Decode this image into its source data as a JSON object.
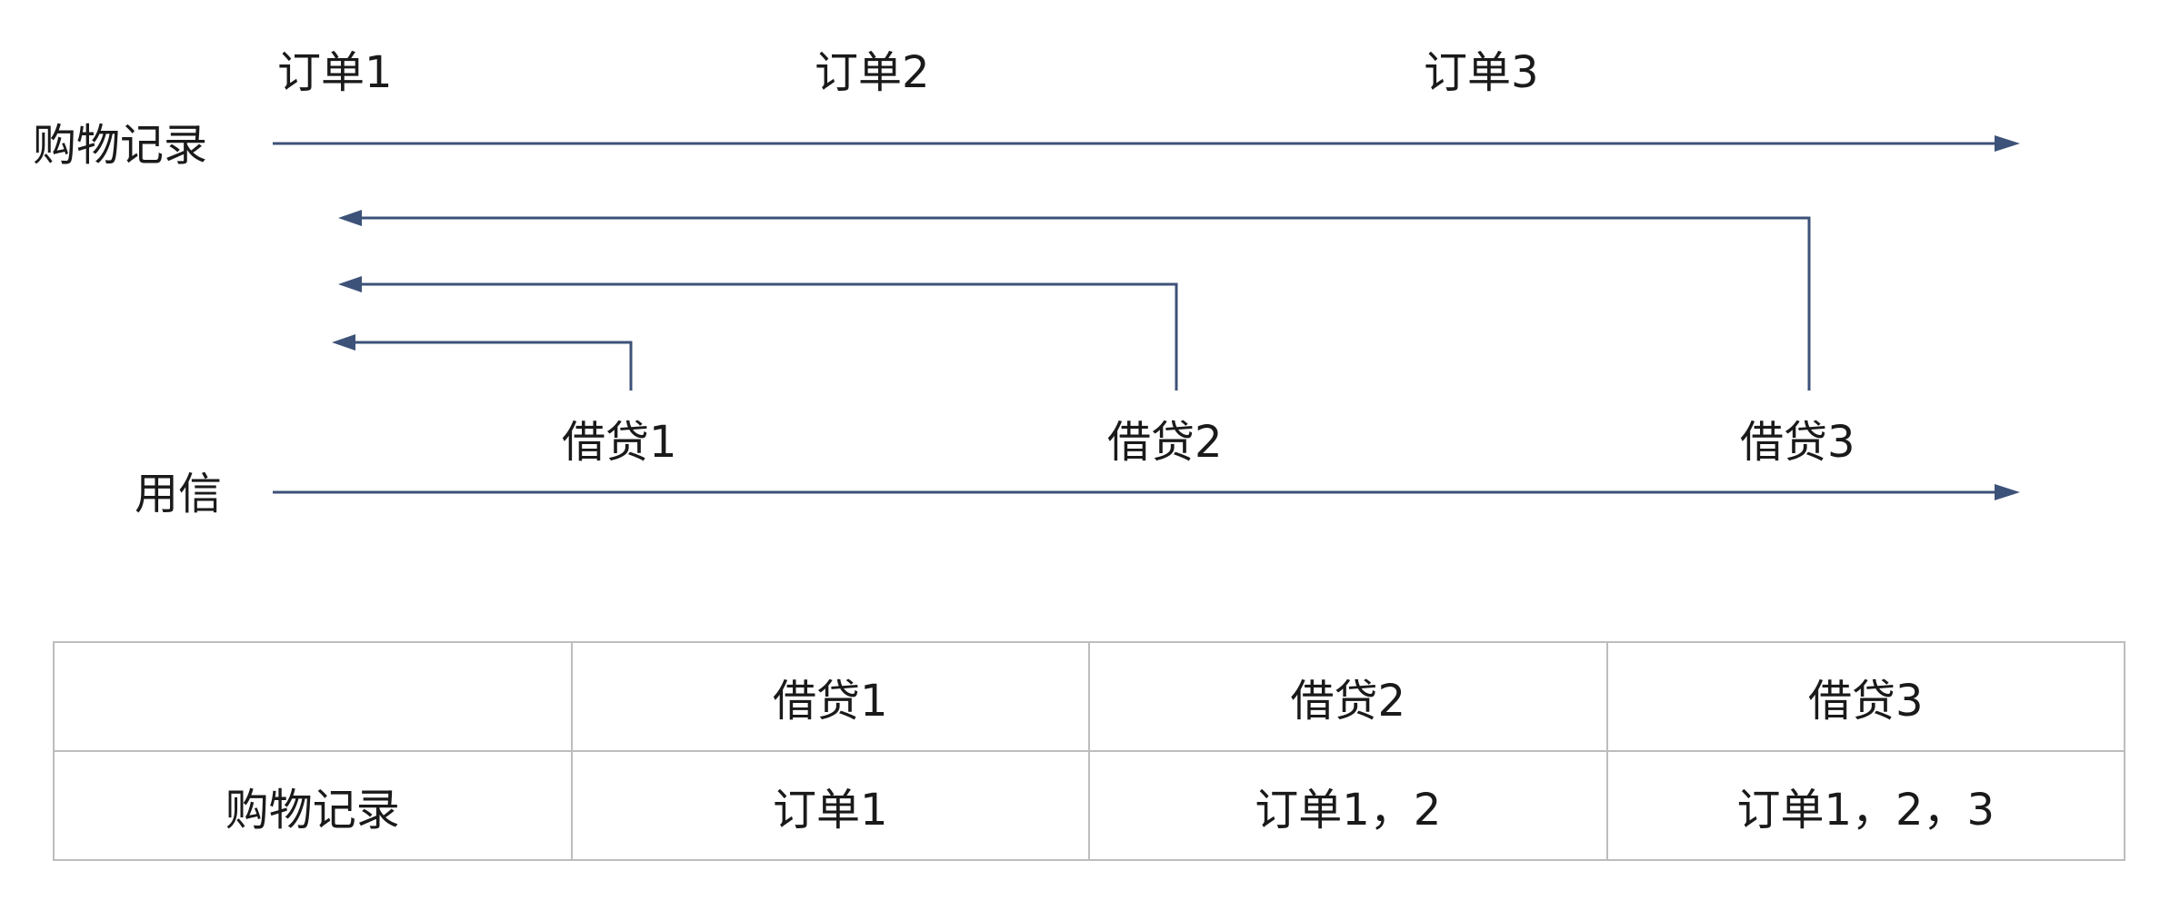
{
  "timeline": {
    "shopping_label": "购物记录",
    "credit_label": "用信",
    "orders": [
      "订单1",
      "订单2",
      "订单3"
    ],
    "loans": [
      "借贷1",
      "借贷2",
      "借贷3"
    ]
  },
  "table": {
    "header": [
      "",
      "借贷1",
      "借贷2",
      "借贷3"
    ],
    "rows": [
      [
        "购物记录",
        "订单1",
        "订单1，2",
        "订单1，2，3"
      ]
    ]
  },
  "colors": {
    "line": "#3d5278",
    "text": "#1a1a1a",
    "table_border": "#bdbdbd"
  }
}
